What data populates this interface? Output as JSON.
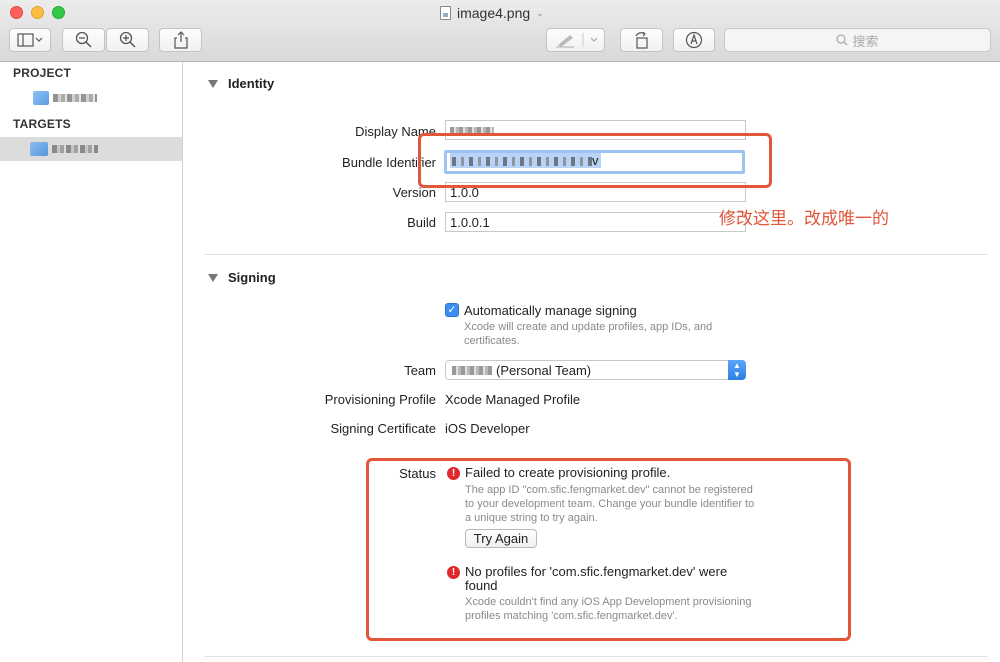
{
  "window": {
    "title": "image4.png",
    "search_placeholder": "搜索"
  },
  "sidebar": {
    "project_header": "PROJECT",
    "targets_header": "TARGETS"
  },
  "identity": {
    "section_title": "Identity",
    "display_name_label": "Display Name",
    "bundle_identifier_label": "Bundle Identifier",
    "bundle_identifier_suffix": "v",
    "version_label": "Version",
    "version_value": "1.0.0",
    "build_label": "Build",
    "build_value": "1.0.0.1"
  },
  "annotation": {
    "text": "修改这里。改成唯一的",
    "color": "#e2563a"
  },
  "signing": {
    "section_title": "Signing",
    "auto_manage_label": "Automatically manage signing",
    "auto_manage_checked": true,
    "auto_manage_desc": "Xcode will create and update profiles, app IDs, and certificates.",
    "team_label": "Team",
    "team_value": "(Personal Team)",
    "profile_label": "Provisioning Profile",
    "profile_value": "Xcode Managed Profile",
    "certificate_label": "Signing Certificate",
    "certificate_value": "iOS Developer",
    "status_label": "Status",
    "errors": [
      {
        "title": "Failed to create provisioning profile.",
        "desc": "The app ID \"com.sfic.fengmarket.dev\" cannot be registered to your development team. Change your bundle identifier to a unique string to try again.",
        "button": "Try Again"
      },
      {
        "title": "No profiles for 'com.sfic.fengmarket.dev' were found",
        "desc": "Xcode couldn't find any iOS App Development provisioning profiles matching 'com.sfic.fengmarket.dev'."
      }
    ]
  },
  "colors": {
    "accent": "#3a8ef0",
    "error": "#e0272c",
    "highlight": "#e2563a"
  }
}
